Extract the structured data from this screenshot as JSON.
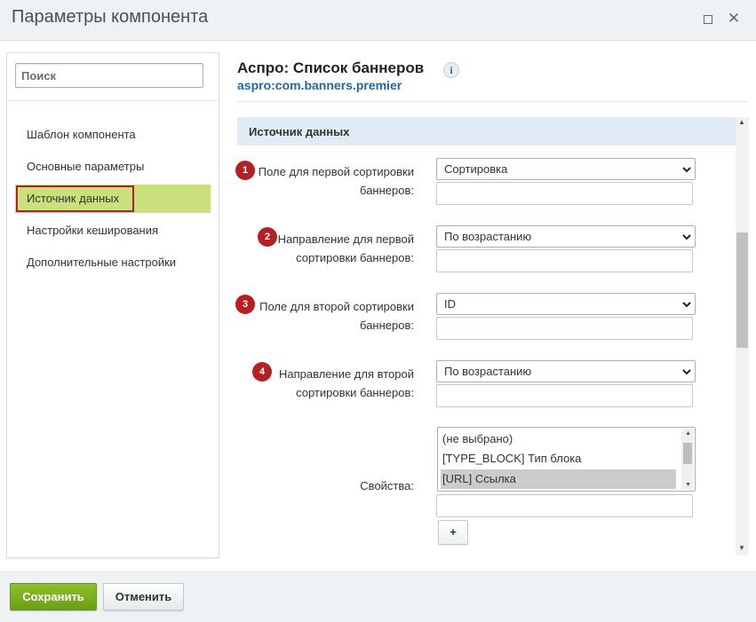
{
  "window": {
    "title": "Параметры компонента",
    "maximize_icon": "maximize-icon",
    "close_icon": "close-icon",
    "close_glyph": "✕"
  },
  "sidebar": {
    "search_placeholder": "Поиск",
    "items": [
      {
        "label": "Шаблон компонента"
      },
      {
        "label": "Основные параметры"
      },
      {
        "label": "Источник данных",
        "active": true
      },
      {
        "label": "Настройки кеширования"
      },
      {
        "label": "Дополнительные настройки"
      }
    ]
  },
  "component": {
    "title": "Аспро: Список баннеров",
    "info_glyph": "i",
    "code": "aspro:com.banners.premier"
  },
  "section": {
    "title": "Источник данных",
    "fields": [
      {
        "badge": "1",
        "label_line1": "Поле для первой сортировки",
        "label_line2": "баннеров:",
        "value": "Сортировка"
      },
      {
        "badge": "2",
        "label_line1": "Направление для первой",
        "label_line2": "сортировки баннеров:",
        "value": "По возрастанию"
      },
      {
        "badge": "3",
        "label_line1": "Поле для второй сортировки",
        "label_line2": "баннеров:",
        "value": "ID"
      },
      {
        "badge": "4",
        "label_line1": "Направление для второй",
        "label_line2": "сортировки баннеров:",
        "value": "По возрастанию"
      }
    ],
    "properties": {
      "label": "Свойства:",
      "options": [
        "(не выбрано)",
        "[TYPE_BLOCK] Тип блока",
        "[URL] Ссылка"
      ],
      "selected": "[URL] Ссылка",
      "add_label": "+"
    }
  },
  "footer": {
    "save_label": "Сохранить",
    "cancel_label": "Отменить"
  },
  "colors": {
    "badge": "#b52025",
    "active_nav": "#c9e07c",
    "section_header": "#e0ebf5",
    "save_button": "#7aad1c",
    "link": "#2467a0"
  }
}
